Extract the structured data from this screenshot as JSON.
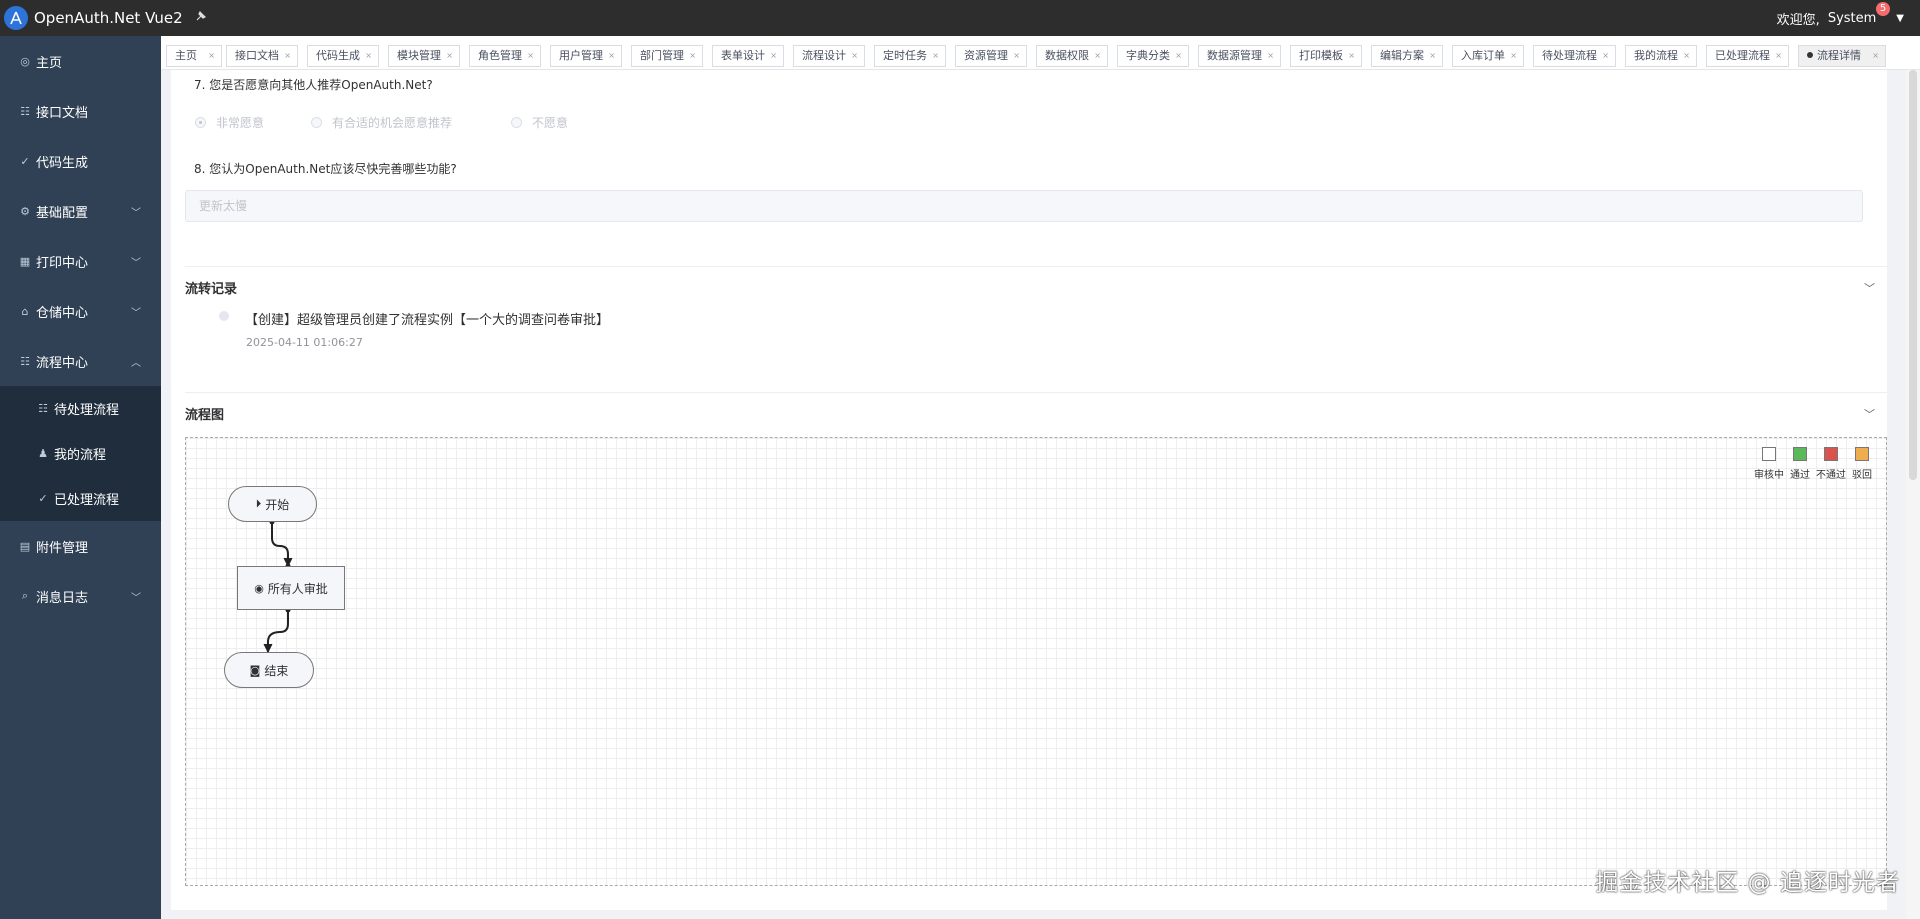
{
  "app": {
    "title": "OpenAuth.Net Vue2"
  },
  "header": {
    "welcome": "欢迎您,",
    "user": "System",
    "badge_count": "5"
  },
  "sidebar": {
    "items": [
      {
        "label": "主页",
        "icon": "home-icon"
      },
      {
        "label": "接口文档",
        "icon": "doc-icon"
      },
      {
        "label": "代码生成",
        "icon": "code-icon"
      },
      {
        "label": "基础配置",
        "icon": "gear-icon"
      },
      {
        "label": "打印中心",
        "icon": "printer-icon"
      },
      {
        "label": "仓储中心",
        "icon": "warehouse-icon"
      },
      {
        "label": "流程中心",
        "icon": "flow-icon"
      },
      {
        "label": "附件管理",
        "icon": "attachment-icon"
      },
      {
        "label": "消息日志",
        "icon": "search-icon"
      }
    ],
    "flow_children": [
      {
        "label": "待处理流程",
        "icon": "pending-icon"
      },
      {
        "label": "我的流程",
        "icon": "user-icon"
      },
      {
        "label": "已处理流程",
        "icon": "check-icon"
      }
    ]
  },
  "tags": [
    "主页",
    "接口文档",
    "代码生成",
    "模块管理",
    "角色管理",
    "用户管理",
    "部门管理",
    "表单设计",
    "流程设计",
    "定时任务",
    "资源管理",
    "数据权限",
    "字典分类",
    "数据源管理",
    "打印模板",
    "编辑方案",
    "入库订单",
    "待处理流程",
    "我的流程",
    "已处理流程",
    "流程详情"
  ],
  "form": {
    "q7": "7. 您是否愿意向其他人推荐OpenAuth.Net?",
    "q7_options": [
      "非常愿意",
      "有合适的机会愿意推荐",
      "不愿意"
    ],
    "q8": "8. 您认为OpenAuth.Net应该尽快完善哪些功能?",
    "q8_answer": "更新太慢"
  },
  "history": {
    "title": "流转记录",
    "entries": [
      {
        "text": "【创建】超级管理员创建了流程实例【一个大的调查问卷审批】",
        "time": "2025-04-11 01:06:27"
      }
    ]
  },
  "flowchart": {
    "title": "流程图",
    "legend": [
      {
        "label": "审核中",
        "color": "#ffffff"
      },
      {
        "label": "通过",
        "color": "#5cb85c"
      },
      {
        "label": "不通过",
        "color": "#d9534f"
      },
      {
        "label": "驳回",
        "color": "#f0ad4e"
      }
    ],
    "nodes": {
      "start": "开始",
      "approve": "所有人审批",
      "end": "结束"
    }
  },
  "watermark": "掘金技术社区 @ 追逐时光者"
}
